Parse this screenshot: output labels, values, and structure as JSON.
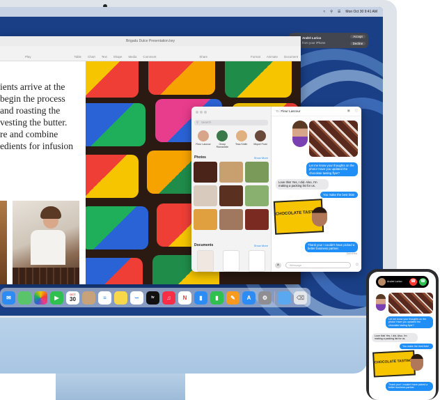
{
  "menubar": {
    "datetime": "Mon Oct 30 9:41 AM"
  },
  "keynote": {
    "window_title": "Brigadu Dulce Presentation.key",
    "toolbar_left": [
      "Play"
    ],
    "toolbar_items": [
      "Table",
      "Chart",
      "Text",
      "Shape",
      "Media",
      "Comment"
    ],
    "toolbar_center": "Share",
    "toolbar_right": [
      "Format",
      "Animate",
      "Document"
    ],
    "slide_lines": [
      "ients arrive at the",
      " begin the process",
      "and roasting the",
      "vesting the butter.",
      "re and combine",
      "edients for infusion"
    ]
  },
  "notification": {
    "name": "André Lorico",
    "subtitle": "from your iPhone",
    "accept": "Accept",
    "decline": "Decline"
  },
  "messages": {
    "to_label": "To:",
    "recipient": "Fleur Lascour",
    "search_placeholder": "Search",
    "contacts": [
      "Fleur Lascour",
      "Group Riamanelie",
      "Tesa Smith",
      "Miquel Frost"
    ],
    "photos_label": "Photos",
    "photos_more": "Show More",
    "documents_label": "Documents",
    "documents_more": "Show More",
    "bubble1": "Let me know your thoughts on the photo! Have you updated the chocolate tasting flyer?",
    "bubble2": "Love this! Yes, I did. Also, I'm making a packing list for us.",
    "bubble3": "You make the best lists!",
    "sticker_text": "CHOCOLATE TASTING",
    "bubble4": "Thank you! I couldn't have picked a better business partner.",
    "delivered": "Delivered",
    "input_placeholder": "iMessage"
  },
  "dock": {
    "calendar_month": "OCT",
    "calendar_day": "30"
  },
  "iphone": {
    "caller": "André Lorico",
    "bubble1": "Let me know your thoughts on the photo! Have you updated the chocolate tasting flyer?",
    "bubble2": "Love this! Yes, I did. Also, I'm making a packing list for us.",
    "bubble3": "You make the best lists!",
    "sticker_text": "CHOCOLATE TASTING",
    "bubble4": "Thank you! I couldn't have picked a better business partner."
  },
  "colors": {
    "imessage_blue": "#1f8ef6",
    "wallpaper_blue": "#1a3f86",
    "accept_green": "#30c04f",
    "decline_red": "#ff3b30"
  },
  "icons": [
    "wifi-icon",
    "search-icon",
    "control-center-icon",
    "camera-icon",
    "video-icon",
    "info-icon",
    "emoji-icon",
    "mic-icon"
  ]
}
